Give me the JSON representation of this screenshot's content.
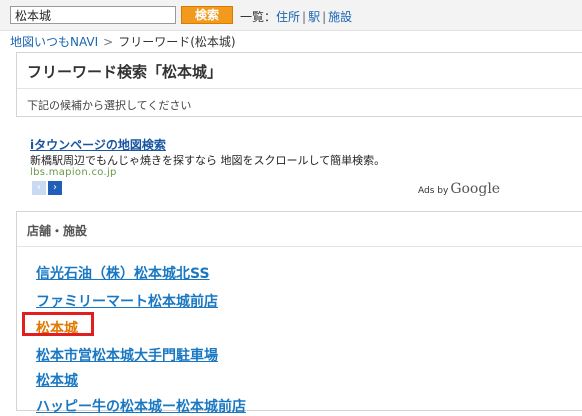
{
  "search": {
    "value": "松本城",
    "button_label": "検索"
  },
  "list_nav": {
    "prefix": "一覧：",
    "items": [
      "住所",
      "駅",
      "施設"
    ],
    "separator": "|"
  },
  "breadcrumb": {
    "home": "地図いつもNAVI",
    "separator": ">",
    "current": "フリーワード(松本城)"
  },
  "header_box": {
    "title": "フリーワード検索「松本城」",
    "description": "下記の候補から選択してください"
  },
  "ad": {
    "title": "iタウンページの地図検索",
    "text": "新橋駅周辺でもんじゃ焼きを探すなら 地図をスクロールして簡単検索。",
    "url": "lbs.mapion.co.jp",
    "prev_symbol": "‹",
    "next_symbol": "›",
    "ads_by_label": "Ads by",
    "google_label": "Google"
  },
  "results_box": {
    "heading": "店舗・施設",
    "items": [
      {
        "label": "信光石油（株）松本城北SS",
        "highlighted": false
      },
      {
        "label": "ファミリーマート松本城前店",
        "highlighted": false
      },
      {
        "label": "松本城",
        "highlighted": true
      },
      {
        "label": "松本市営松本城大手門駐車場",
        "highlighted": false
      },
      {
        "label": "松本城",
        "highlighted": false
      },
      {
        "label": "ハッピー牛の松本城ー松本城前店",
        "highlighted": false
      }
    ]
  },
  "colors": {
    "link": "#1a78c2",
    "highlight_link": "#e07800",
    "search_button": "#f29a1e",
    "highlight_border": "#e02020"
  }
}
